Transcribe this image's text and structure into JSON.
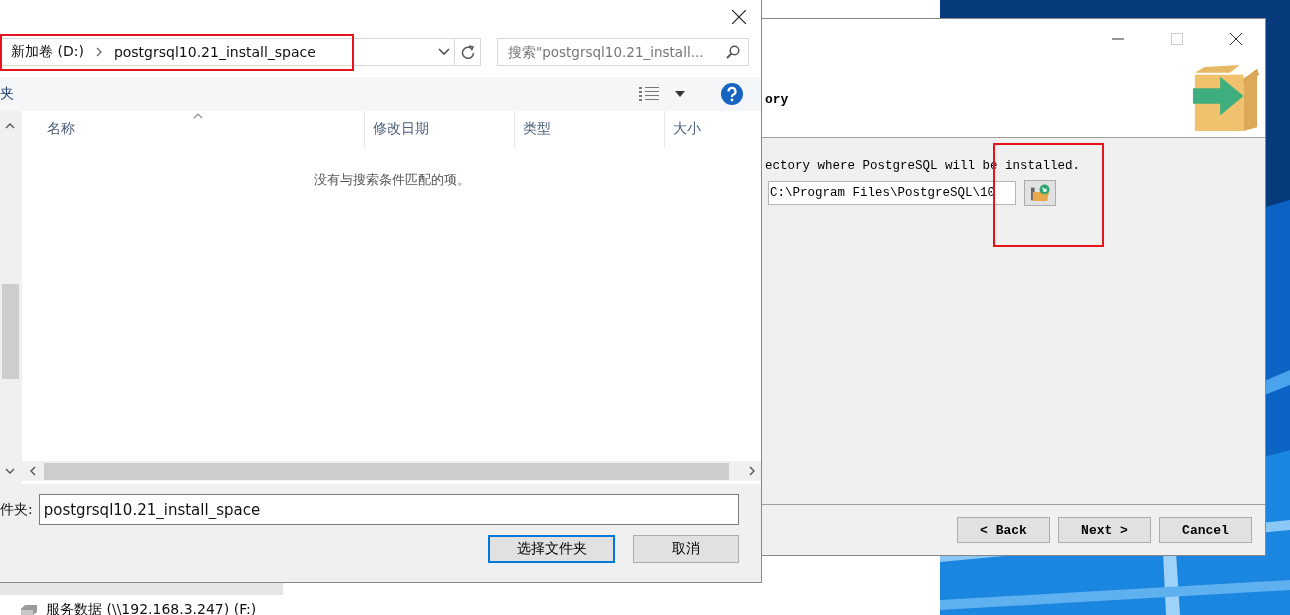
{
  "explorer_nav": [
    {
      "label": "服务数据 (\\\\192.168.3.247) (F:)",
      "selected": false
    }
  ],
  "file_dialog": {
    "breadcrumb": [
      {
        "label": "新加卷 (D:)"
      },
      {
        "label": "postgrsql10.21_install_space"
      }
    ],
    "search": {
      "placeholder": "搜索\"postgrsql10.21_install..."
    },
    "toolbar_label": "夹",
    "columns": [
      {
        "label": "名称",
        "sorted": true
      },
      {
        "label": "修改日期",
        "sorted": false
      },
      {
        "label": "类型",
        "sorted": false
      },
      {
        "label": "大小",
        "sorted": false
      }
    ],
    "empty_message": "没有与搜索条件匹配的项。",
    "folder_label": "件夹:",
    "folder_value": "postgrsql10.21_install_space",
    "buttons": [
      {
        "label": "选择文件夹",
        "default": true
      },
      {
        "label": "取消",
        "default": false
      }
    ]
  },
  "installer": {
    "heading": "ory",
    "instruction": "ectory where PostgreSQL will be installed.",
    "path_value": "C:\\Program Files\\PostgreSQL\\10",
    "buttons": [
      {
        "label": "< Back"
      },
      {
        "label": "Next >"
      },
      {
        "label": "Cancel"
      }
    ]
  },
  "red_frames": {
    "address_bar": true,
    "browse_button": true
  }
}
